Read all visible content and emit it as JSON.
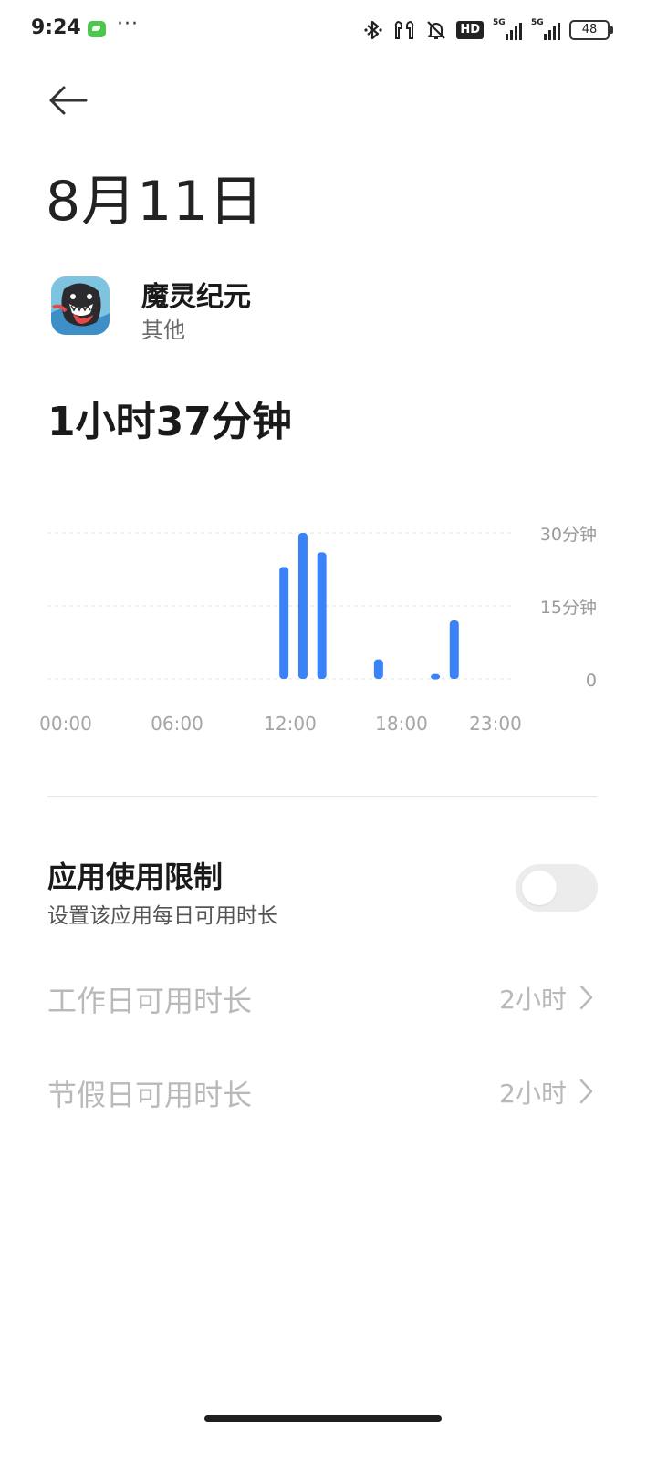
{
  "status_bar": {
    "time": "9:24",
    "more": "···",
    "hd": "HD",
    "sim1": "5G",
    "sim2": "5G",
    "battery": "48",
    "icons": [
      "bluetooth-icon",
      "earbuds-icon",
      "bell-muted-icon"
    ]
  },
  "header": {
    "title": "8月11日",
    "back_icon": "arrow-left-icon"
  },
  "app": {
    "name": "魔灵纪元",
    "category": "其他",
    "icon": "app-icon-monster"
  },
  "usage": {
    "total": "1小时37分钟"
  },
  "chart_data": {
    "type": "bar",
    "x_tick_labels": [
      "00:00",
      "06:00",
      "12:00",
      "18:00",
      "23:00"
    ],
    "y_tick_labels": [
      "30分钟",
      "15分钟",
      "0"
    ],
    "ylim": [
      0,
      30
    ],
    "grid": true,
    "color": "#3a82f7",
    "x": [
      12,
      13,
      14,
      15,
      16,
      17,
      18,
      19,
      20
    ],
    "values": [
      23,
      30,
      26,
      0,
      0,
      4,
      0,
      0,
      1,
      12
    ]
  },
  "limit": {
    "title": "应用使用限制",
    "description": "设置该应用每日可用时长",
    "enabled": false
  },
  "settings": [
    {
      "label": "工作日可用时长",
      "value": "2小时"
    },
    {
      "label": "节假日可用时长",
      "value": "2小时"
    }
  ],
  "colors": {
    "accent": "#3a82f7",
    "disabled_text": "#b9b9b9"
  }
}
